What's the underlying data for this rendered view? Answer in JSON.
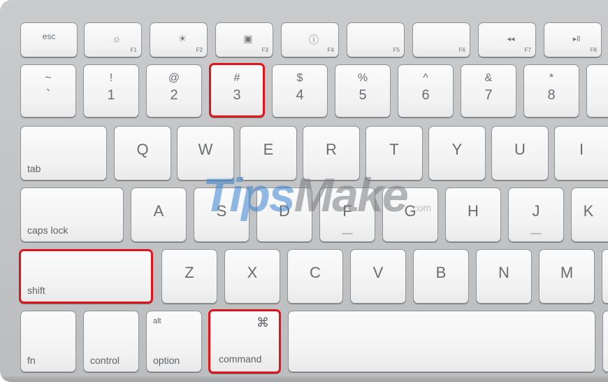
{
  "highlight_color": "#e0141a",
  "watermark": {
    "main": "Tips",
    "accent": "Make",
    "suffix": ".com"
  },
  "function_row": [
    {
      "id": "esc",
      "label": "esc",
      "icon": "",
      "sub": ""
    },
    {
      "id": "f1",
      "label": "",
      "icon": "brightness-low-icon",
      "glyph": "☼",
      "sub": "F1"
    },
    {
      "id": "f2",
      "label": "",
      "icon": "brightness-high-icon",
      "glyph": "☀",
      "sub": "F2"
    },
    {
      "id": "f3",
      "label": "",
      "icon": "mission-control-icon",
      "glyph": "▣",
      "sub": "F3"
    },
    {
      "id": "f4",
      "label": "",
      "icon": "dashboard-icon",
      "glyph": "ⓘ",
      "sub": "F4"
    },
    {
      "id": "f5",
      "label": "",
      "icon": "",
      "glyph": "",
      "sub": "F5"
    },
    {
      "id": "f6",
      "label": "",
      "icon": "",
      "glyph": "",
      "sub": "F6"
    },
    {
      "id": "f7",
      "label": "",
      "icon": "rewind-icon",
      "glyph": "◂◂",
      "sub": "F7"
    },
    {
      "id": "f8",
      "label": "",
      "icon": "play-pause-icon",
      "glyph": "▸ll",
      "sub": "F8"
    }
  ],
  "number_row": [
    {
      "top": "~",
      "bottom": "`"
    },
    {
      "top": "!",
      "bottom": "1"
    },
    {
      "top": "@",
      "bottom": "2"
    },
    {
      "top": "#",
      "bottom": "3"
    },
    {
      "top": "$",
      "bottom": "4"
    },
    {
      "top": "%",
      "bottom": "5"
    },
    {
      "top": "^",
      "bottom": "6"
    },
    {
      "top": "&",
      "bottom": "7"
    },
    {
      "top": "*",
      "bottom": "8"
    }
  ],
  "tab_row": {
    "modifier": "tab",
    "letters": [
      "Q",
      "W",
      "E",
      "R",
      "T",
      "Y",
      "U",
      "I"
    ]
  },
  "caps_row": {
    "modifier": "caps lock",
    "letters": [
      "A",
      "S",
      "D",
      "F",
      "G",
      "H",
      "J",
      "K"
    ]
  },
  "shift_row": {
    "modifier": "shift",
    "letters": [
      "Z",
      "X",
      "C",
      "V",
      "B",
      "N",
      "M"
    ]
  },
  "bottom_row": {
    "fn": "fn",
    "control": "control",
    "option_top": "alt",
    "option": "option",
    "command_symbol": "⌘",
    "command": "command"
  },
  "highlighted_keys": [
    "3",
    "shift",
    "command"
  ]
}
